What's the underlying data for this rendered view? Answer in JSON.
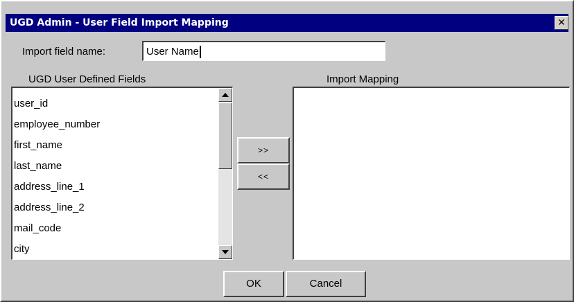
{
  "window": {
    "title": "UGD Admin - User Field Import Mapping",
    "close_glyph": "✕"
  },
  "import_field": {
    "label": "Import field name:",
    "value": "User Name"
  },
  "user_defined_fields": {
    "header": "UGD User Defined Fields",
    "items": [
      "user_id",
      "employee_number",
      "first_name",
      "last_name",
      "address_line_1",
      "address_line_2",
      "mail_code",
      "city"
    ]
  },
  "import_mapping": {
    "header": "Import Mapping",
    "items": []
  },
  "buttons": {
    "add": ">>",
    "remove": "<<",
    "ok": "OK",
    "cancel": "Cancel"
  },
  "colors": {
    "titlebar": "#000080",
    "dialog_bg": "#c8c8c8",
    "list_bg": "#ffffff"
  },
  "icons": {
    "close": "close-icon",
    "scroll_up": "arrow-up-icon",
    "scroll_down": "arrow-down-icon"
  }
}
